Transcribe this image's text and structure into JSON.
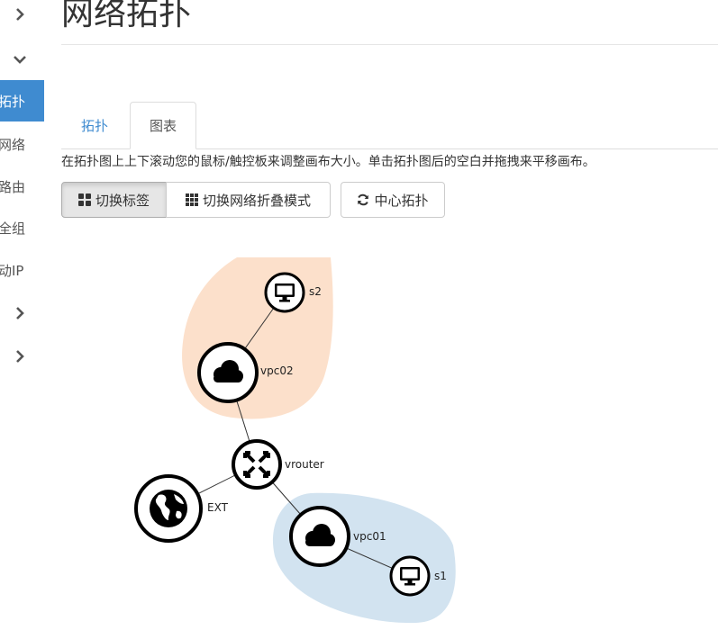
{
  "page": {
    "title": "网络拓扑"
  },
  "sidebar": {
    "items": [
      {
        "label": "拓扑",
        "active": true
      },
      {
        "label": "网络"
      },
      {
        "label": "路由"
      },
      {
        "label": "全组"
      },
      {
        "label": "动IP"
      }
    ]
  },
  "tabs": [
    {
      "label": "拓扑",
      "active": false
    },
    {
      "label": "图表",
      "active": true
    }
  ],
  "hint": "在拓扑图上上下滚动您的鼠标/触控板来调整画布大小。单击拓扑图后的空白并拖拽来平移画布。",
  "toolbar": {
    "toggle_labels": "切换标签",
    "toggle_collapse": "切换网络折叠模式",
    "center_topology": "中心拓扑"
  },
  "topology": {
    "nodes": {
      "s2": "s2",
      "vpc02": "vpc02",
      "vrouter": "vrouter",
      "ext": "EXT",
      "vpc01": "vpc01",
      "s1": "s1"
    },
    "colors": {
      "vpc02_group": "#fce0cb",
      "vpc01_group": "#d2e3f0",
      "accent": "#3f8bd0"
    }
  }
}
